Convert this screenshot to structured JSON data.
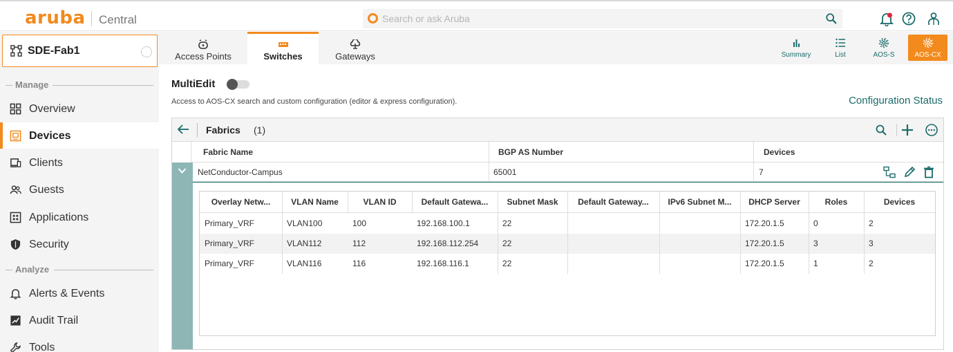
{
  "header": {
    "logo": "aruba",
    "product": "Central",
    "search_placeholder": "Search or ask Aruba"
  },
  "sidebar": {
    "fabric_selector": "SDE-Fab1",
    "sections": {
      "manage": "Manage",
      "analyze": "Analyze"
    },
    "items": [
      {
        "label": "Overview",
        "icon": "grid-icon"
      },
      {
        "label": "Devices",
        "icon": "devices-icon",
        "active": true
      },
      {
        "label": "Clients",
        "icon": "clients-icon"
      },
      {
        "label": "Guests",
        "icon": "guests-icon"
      },
      {
        "label": "Applications",
        "icon": "applications-icon"
      },
      {
        "label": "Security",
        "icon": "shield-icon"
      },
      {
        "label": "Alerts & Events",
        "icon": "bell-icon"
      },
      {
        "label": "Audit Trail",
        "icon": "audit-trail-icon"
      },
      {
        "label": "Tools",
        "icon": "wrench-icon"
      }
    ]
  },
  "tabs": [
    {
      "label": "Access Points",
      "icon": "access-point-icon"
    },
    {
      "label": "Switches",
      "icon": "switch-icon",
      "active": true
    },
    {
      "label": "Gateways",
      "icon": "gateway-icon"
    }
  ],
  "view_buttons": [
    {
      "label": "Summary",
      "icon": "bar-chart-icon"
    },
    {
      "label": "List",
      "icon": "list-icon"
    },
    {
      "label": "AOS-S",
      "icon": "gear-icon"
    },
    {
      "label": "AOS-CX",
      "icon": "gear-icon",
      "active": true
    }
  ],
  "multiedit": {
    "label": "MultiEdit",
    "enabled": false,
    "description": "Access to AOS-CX search and custom configuration (editor & express configuration)."
  },
  "config_status": "Configuration Status",
  "fabrics": {
    "title": "Fabrics",
    "count": "(1)",
    "columns": [
      "Fabric Name",
      "BGP AS Number",
      "Devices"
    ],
    "rows": [
      {
        "name": "NetConductor-Campus",
        "bgp_as": "65001",
        "devices": "7"
      }
    ]
  },
  "overlay_table": {
    "columns": [
      "Overlay Netw...",
      "VLAN Name",
      "VLAN ID",
      "Default Gatewa...",
      "Subnet Mask",
      "Default Gateway...",
      "IPv6 Subnet M...",
      "DHCP Server",
      "Roles",
      "Devices"
    ],
    "rows": [
      [
        "Primary_VRF",
        "VLAN100",
        "100",
        "192.168.100.1",
        "22",
        "",
        "",
        "172.20.1.5",
        "0",
        "2"
      ],
      [
        "Primary_VRF",
        "VLAN112",
        "112",
        "192.168.112.254",
        "22",
        "",
        "",
        "172.20.1.5",
        "3",
        "3"
      ],
      [
        "Primary_VRF",
        "VLAN116",
        "116",
        "192.168.116.1",
        "22",
        "",
        "",
        "172.20.1.5",
        "1",
        "2"
      ]
    ]
  },
  "colors": {
    "brand_orange": "#f28a1d",
    "teal": "#1a6b6a",
    "expand_strip": "#8db6b5",
    "notification_red": "#e0263c"
  }
}
